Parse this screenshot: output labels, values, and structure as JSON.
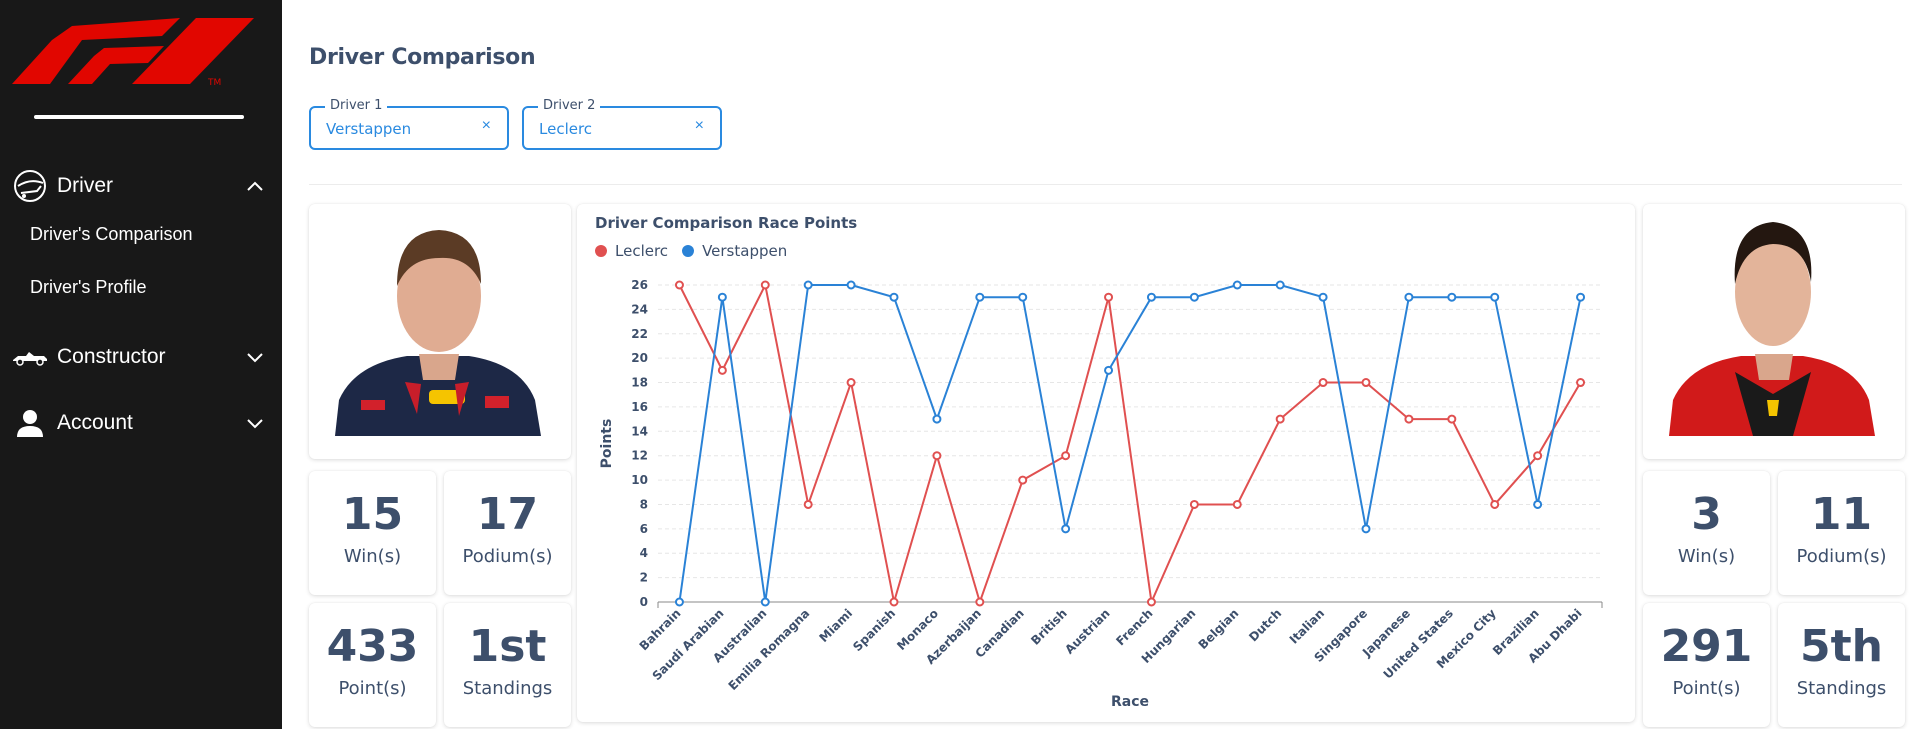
{
  "sidebar": {
    "logo_icon": "f1-logo",
    "driver": {
      "label": "Driver",
      "icon": "helmet-icon",
      "expanded": true
    },
    "sub_items": [
      "Driver's Comparison",
      "Driver's Profile"
    ],
    "constructor": {
      "label": "Constructor",
      "icon": "racecar-icon",
      "expanded": false
    },
    "account": {
      "label": "Account",
      "icon": "person-icon",
      "expanded": false
    }
  },
  "page": {
    "title": "Driver Comparison"
  },
  "selectors": {
    "driver1": {
      "label": "Driver 1",
      "value": "Verstappen",
      "clear": "×"
    },
    "driver2": {
      "label": "Driver 2",
      "value": "Leclerc",
      "clear": "×"
    }
  },
  "left_driver": {
    "name": "Verstappen",
    "photo_icon": "driver-photo-verstappen",
    "wins": "15",
    "wins_label": "Win(s)",
    "podiums": "17",
    "podiums_label": "Podium(s)",
    "points": "433",
    "points_label": "Point(s)",
    "standing": "1st",
    "standing_label": "Standings"
  },
  "right_driver": {
    "name": "Leclerc",
    "photo_icon": "driver-photo-leclerc",
    "wins": "3",
    "wins_label": "Win(s)",
    "podiums": "11",
    "podiums_label": "Podium(s)",
    "points": "291",
    "points_label": "Point(s)",
    "standing": "5th",
    "standing_label": "Standings"
  },
  "colors": {
    "leclerc": "#e05050",
    "verstappen": "#2a82d6",
    "title": "#3d4f6b",
    "accent": "#2a8ae0",
    "f1_red": "#e10600"
  },
  "chart_data": {
    "type": "line",
    "title": "Driver Comparison Race Points",
    "xlabel": "Race",
    "ylabel": "Points",
    "ylim": [
      0,
      26
    ],
    "yticks": [
      0,
      2,
      4,
      6,
      8,
      10,
      12,
      14,
      16,
      18,
      20,
      22,
      24,
      26
    ],
    "grid": true,
    "legend_position": "top-left",
    "categories": [
      "Bahrain",
      "Saudi Arabian",
      "Australian",
      "Emilia Romagna",
      "Miami",
      "Spanish",
      "Monaco",
      "Azerbaijan",
      "Canadian",
      "British",
      "Austrian",
      "French",
      "Hungarian",
      "Belgian",
      "Dutch",
      "Italian",
      "Singapore",
      "Japanese",
      "United States",
      "Mexico City",
      "Brazilian",
      "Abu Dhabi"
    ],
    "series": [
      {
        "name": "Leclerc",
        "color": "#e05050",
        "values": [
          26,
          19,
          26,
          8,
          18,
          0,
          12,
          0,
          10,
          12,
          25,
          0,
          8,
          8,
          15,
          18,
          18,
          15,
          15,
          8,
          12,
          18
        ]
      },
      {
        "name": "Verstappen",
        "color": "#2a82d6",
        "values": [
          0,
          25,
          0,
          26,
          26,
          25,
          15,
          25,
          25,
          6,
          19,
          25,
          25,
          26,
          26,
          25,
          6,
          25,
          25,
          25,
          8,
          25
        ]
      }
    ]
  }
}
